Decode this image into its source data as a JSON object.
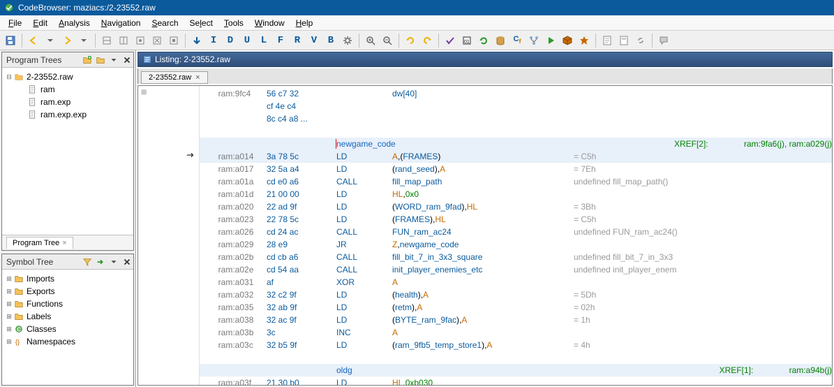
{
  "window": {
    "title": "CodeBrowser: maziacs:/2-23552.raw"
  },
  "menu": {
    "items": [
      "File",
      "Edit",
      "Analysis",
      "Navigation",
      "Search",
      "Select",
      "Tools",
      "Window",
      "Help"
    ]
  },
  "panels": {
    "program_trees": {
      "title": "Program Trees",
      "root": "2-23552.raw",
      "children": [
        "ram",
        "ram.exp",
        "ram.exp.exp"
      ],
      "tab": "Program Tree"
    },
    "symbol_tree": {
      "title": "Symbol Tree",
      "items": [
        "Imports",
        "Exports",
        "Functions",
        "Labels",
        "Classes",
        "Namespaces"
      ]
    }
  },
  "listing": {
    "title": "Listing: 2-23552.raw",
    "tab": "2-23552.raw",
    "rows": [
      {
        "addr": "ram:9fc4",
        "bytes": "56 c7 32",
        "mnem": "",
        "op": "dw[40]",
        "kind": "data"
      },
      {
        "addr": "",
        "bytes": "cf 4e c4",
        "mnem": "",
        "op": ""
      },
      {
        "addr": "",
        "bytes": "8c c4 a8",
        "ell": "...",
        "mnem": "",
        "op": ""
      },
      {
        "label": "newgame_code",
        "xref": "XREF[2]:",
        "xref_refs": "ram:9fa6(j), ram:a029(j)"
      },
      {
        "addr": "ram:a014",
        "bytes": "3a 78 5c",
        "mnem": "LD",
        "op": [
          "A",
          ",",
          "(",
          "FRAMES",
          ")"
        ],
        "cmt": "= C5h"
      },
      {
        "addr": "ram:a017",
        "bytes": "32 5a a4",
        "mnem": "LD",
        "op": [
          "(",
          "rand_seed",
          ")",
          ",",
          "A"
        ],
        "cmt": "= 7Eh"
      },
      {
        "addr": "ram:a01a",
        "bytes": "cd e0 a6",
        "mnem": "CALL",
        "op": [
          "fill_map_path"
        ],
        "cmt": "undefined fill_map_path()"
      },
      {
        "addr": "ram:a01d",
        "bytes": "21 00 00",
        "mnem": "LD",
        "op": [
          "HL",
          ",",
          "0x0"
        ]
      },
      {
        "addr": "ram:a020",
        "bytes": "22 ad 9f",
        "mnem": "LD",
        "op": [
          "(",
          "WORD_ram_9fad",
          ")",
          ",",
          "HL"
        ],
        "cmt": "= 3Bh"
      },
      {
        "addr": "ram:a023",
        "bytes": "22 78 5c",
        "mnem": "LD",
        "op": [
          "(",
          "FRAMES",
          ")",
          ",",
          "HL"
        ],
        "cmt": "= C5h"
      },
      {
        "addr": "ram:a026",
        "bytes": "cd 24 ac",
        "mnem": "CALL",
        "op": [
          "FUN_ram_ac24"
        ],
        "cmt": "undefined FUN_ram_ac24()"
      },
      {
        "addr": "ram:a029",
        "bytes": "28 e9",
        "mnem": "JR",
        "op": [
          "Z",
          ",",
          "newgame_code"
        ]
      },
      {
        "addr": "ram:a02b",
        "bytes": "cd cb a6",
        "mnem": "CALL",
        "op": [
          "fill_bit_7_in_3x3_square"
        ],
        "cmt": "undefined fill_bit_7_in_3x3"
      },
      {
        "addr": "ram:a02e",
        "bytes": "cd 54 aa",
        "mnem": "CALL",
        "op": [
          "init_player_enemies_etc"
        ],
        "cmt": "undefined init_player_enem"
      },
      {
        "addr": "ram:a031",
        "bytes": "af",
        "mnem": "XOR",
        "op": [
          "A"
        ]
      },
      {
        "addr": "ram:a032",
        "bytes": "32 c2 9f",
        "mnem": "LD",
        "op": [
          "(",
          "health",
          ")",
          ",",
          "A"
        ],
        "cmt": "= 5Dh"
      },
      {
        "addr": "ram:a035",
        "bytes": "32 ab 9f",
        "mnem": "LD",
        "op": [
          "(",
          "retm",
          ")",
          ",",
          "A"
        ],
        "cmt": "= 02h"
      },
      {
        "addr": "ram:a038",
        "bytes": "32 ac 9f",
        "mnem": "LD",
        "op": [
          "(",
          "BYTE_ram_9fac",
          ")",
          ",",
          "A"
        ],
        "cmt": "= 1h"
      },
      {
        "addr": "ram:a03b",
        "bytes": "3c",
        "mnem": "INC",
        "op": [
          "A"
        ]
      },
      {
        "addr": "ram:a03c",
        "bytes": "32 b5 9f",
        "mnem": "LD",
        "op": [
          "(",
          "ram_9fb5_temp_store1",
          ")",
          ",",
          "A"
        ],
        "cmt": "= 4h"
      },
      {
        "label": "oldg",
        "xref": "XREF[1]:",
        "xref_refs": "ram:a94b(j)"
      },
      {
        "addr": "ram:a03f",
        "bytes": "21 30 b0",
        "mnem": "LD",
        "op": [
          "HL",
          ",",
          "0xb030"
        ],
        "partial": true
      }
    ]
  }
}
